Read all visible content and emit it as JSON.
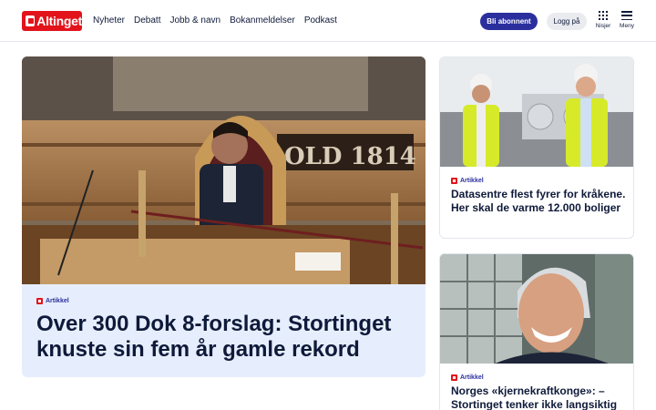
{
  "header": {
    "logo_text": "Altinget",
    "nav": [
      "Nyheter",
      "Debatt",
      "Jobb & navn",
      "Bokanmeldelser",
      "Podkast"
    ],
    "subscribe_label": "Bli abonnent",
    "login_label": "Logg på",
    "niches_label": "Nisjer",
    "menu_label": "Meny"
  },
  "main_article": {
    "badge": "Artikkel",
    "title": "Over 300 Dok 8-forslag: Stortinget knuste sin fem år gamle rekord",
    "image_caption_text": "OLD 1814"
  },
  "side_articles": [
    {
      "badge": "Artikkel",
      "title": "Datasentre flest fyrer for kråkene. Her skal de varme 12.000 boliger"
    },
    {
      "badge": "Artikkel",
      "title": "Norges «kjernekraftkonge»: – Stortinget tenker ikke langsiktig"
    }
  ],
  "colors": {
    "brand_red": "#e3131b",
    "accent_blue": "#2b2f9e",
    "card_bg": "#e6eefd",
    "text": "#0f1a3a"
  }
}
